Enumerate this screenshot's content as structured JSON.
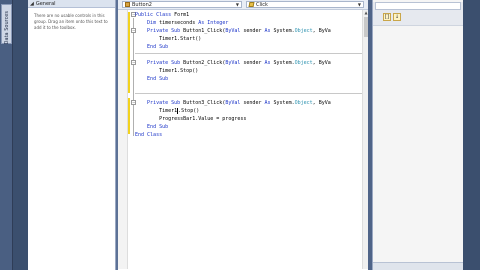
{
  "left_strip": {
    "tab_label": "Data Sources"
  },
  "toolbox": {
    "group_title": "General",
    "empty_message": "There are no usable controls in this group. Drag an item onto this text to add it to the toolbox."
  },
  "editor": {
    "class_combo": "Button2",
    "method_combo": "Click",
    "code_lines": [
      {
        "text": "Public Class Form1"
      },
      {
        "text": "Dim timerseconds As Integer"
      },
      {
        "text": "Private Sub Button1_Click(ByVal sender As System.Object, ByVa"
      },
      {
        "text": "Timer1.Start()"
      },
      {
        "text": "End Sub"
      },
      {
        "text": "Private Sub Button2_Click(ByVal sender As System.Object, ByVa"
      },
      {
        "text": "Timer1.Stop()"
      },
      {
        "text": "End Sub"
      },
      {
        "text": "Private Sub Button3_Click(ByVal sender As System.Object, ByVa"
      },
      {
        "text": "Timer1.Stop()"
      },
      {
        "text": "ProgressBar1.Value = progress"
      },
      {
        "text": "End Sub"
      },
      {
        "text": "End Class"
      }
    ]
  },
  "properties": {
    "categorized_label": "[]",
    "sort_glyph": "↓"
  },
  "colors": {
    "keyword": "#1a33c8",
    "type": "#2b91af",
    "change_bar": "#f2d21e",
    "shell_background": "#3b4f6e"
  }
}
